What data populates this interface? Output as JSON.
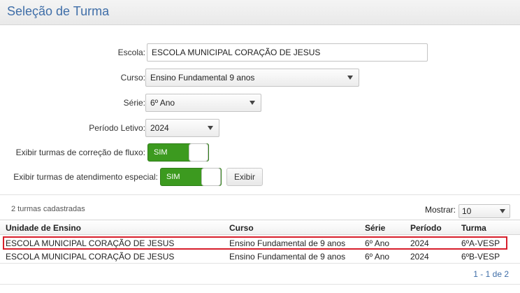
{
  "header": {
    "title": "Seleção de Turma"
  },
  "form": {
    "escola_label": "Escola:",
    "escola_value": "ESCOLA MUNICIPAL CORAÇÃO DE JESUS",
    "curso_label": "Curso:",
    "curso_value": "Ensino Fundamental 9 anos",
    "serie_label": "Série:",
    "serie_value": "6º Ano",
    "periodo_label": "Período Letivo:",
    "periodo_value": "2024",
    "fluxo_label": "Exibir turmas de correção de fluxo:",
    "fluxo_toggle": "SIM",
    "especial_label": "Exibir turmas de atendimento especial:",
    "especial_toggle": "SIM",
    "exibir_button": "Exibir"
  },
  "list": {
    "count_text": "2 turmas cadastradas",
    "mostrar_label": "Mostrar:",
    "page_size": "10",
    "columns": {
      "unidade": "Unidade de Ensino",
      "curso": "Curso",
      "serie": "Série",
      "periodo": "Período",
      "turma": "Turma"
    },
    "rows": [
      {
        "unidade": "ESCOLA MUNICIPAL CORAÇÃO DE JESUS",
        "curso": "Ensino Fundamental de 9 anos",
        "serie": "6º Ano",
        "periodo": "2024",
        "turma": "6ºA-VESP",
        "highlighted": true
      },
      {
        "unidade": "ESCOLA MUNICIPAL CORAÇÃO DE JESUS",
        "curso": "Ensino Fundamental de 9 anos",
        "serie": "6º Ano",
        "periodo": "2024",
        "turma": "6ºB-VESP",
        "highlighted": false
      }
    ],
    "pager_text": "1 - 1 de 2"
  },
  "colors": {
    "title_blue": "#3f6ea8",
    "toggle_green": "#3c9a1f",
    "highlight_red": "#d71f2b"
  },
  "icons": {
    "dropdown": "chevron-down-icon"
  }
}
